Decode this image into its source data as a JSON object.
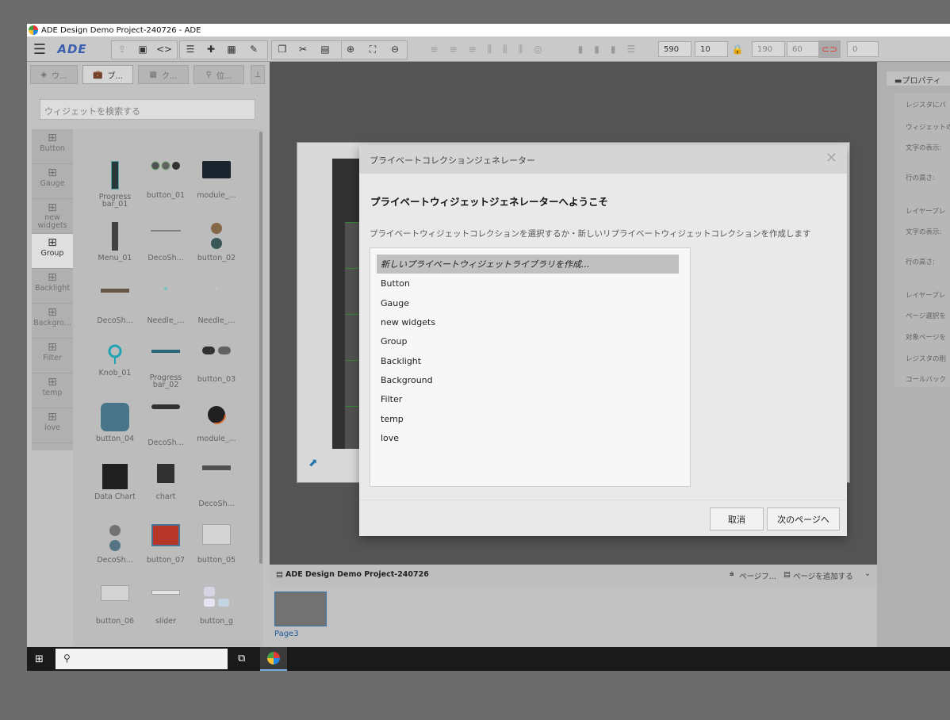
{
  "window": {
    "title": "ADE Design Demo Project-240726 - ADE"
  },
  "toolbar": {
    "x_value": "590",
    "y_value": "10",
    "w_value": "190",
    "h_value": "60",
    "r_value": "0"
  },
  "left_tabs": [
    "ウ...",
    "ブ...",
    "ク...",
    "位..."
  ],
  "search": {
    "placeholder": "ウィジェットを検索する"
  },
  "categories": [
    "Button",
    "Gauge",
    "new widgets",
    "Group",
    "Backlight",
    "Backgro...",
    "Filter",
    "temp",
    "love"
  ],
  "widgets": [
    "Progress bar_01",
    "button_01",
    "module_...",
    "Menu_01",
    "DecoSh...",
    "button_02",
    "DecoSh...",
    "Needle_...",
    "Needle_...",
    "Knob_01",
    "Progress bar_02",
    "button_03",
    "button_04",
    "DecoSh...",
    "module_...",
    "Data Chart",
    "chart",
    "DecoSh...",
    "DecoSh...",
    "button_07",
    "button_05",
    "button_06",
    "slider",
    "button_g"
  ],
  "bottom": {
    "project_name": "ADE Design Demo Project-240726",
    "page_filter": "ページフ...",
    "add_page": "ページを追加する",
    "page_label": "Page3"
  },
  "right_panel": {
    "header": "プロパティ",
    "rows": [
      "レジスタにバ",
      "ウィジェットの",
      "文字の表示:",
      "行の高さ:",
      "レイヤープレ",
      "文字の表示:",
      "行の高さ:",
      "レイヤープレ",
      "ページ選択を",
      "対象ページを",
      "レジスタの削",
      "コールバック"
    ]
  },
  "modal": {
    "header": "プライベートコレクションジェネレーター",
    "title": "プライベートウィジェットジェネレーターへようこそ",
    "description": "プライベートウィジェットコレクションを選択するか・新しいリプライベートウィジェットコレクションを作成します",
    "items": [
      "新しいプライベートウィジェットライブラリを作成...",
      "Button",
      "Gauge",
      "new widgets",
      "Group",
      "Backlight",
      "Background",
      "Filter",
      "temp",
      "love"
    ],
    "cancel": "取消",
    "next": "次のページへ"
  },
  "colors": {
    "accent": "#e53935",
    "taskbar": "#1a1a1a"
  }
}
